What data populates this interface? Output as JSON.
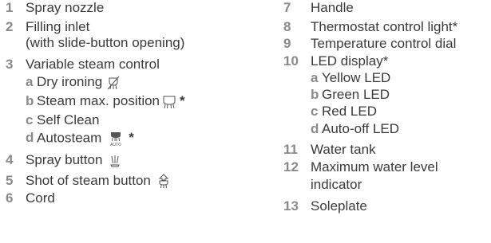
{
  "left_items": [
    {
      "num": "1",
      "label": "Spray nozzle"
    },
    {
      "num": "2",
      "label": "Filling inlet",
      "cont": "(with slide-button opening)"
    },
    {
      "num": "3",
      "label": "Variable steam control",
      "subs": [
        {
          "letter": "a",
          "label": "Dry ironing",
          "icon": "dry-ironing-icon"
        },
        {
          "letter": "b",
          "label": "Steam max. position",
          "icon": "steam-max-icon",
          "star": "*"
        },
        {
          "letter": "c",
          "label": "Self Clean"
        },
        {
          "letter": "d",
          "label": "Autosteam",
          "icon": "autosteam-icon",
          "icon_text": "AUTO",
          "star": "*"
        }
      ]
    },
    {
      "num": "4",
      "label": "Spray button",
      "icon": "spray-icon"
    },
    {
      "num": "5",
      "label": "Shot of steam button",
      "icon": "shot-of-steam-icon"
    },
    {
      "num": "6",
      "label": "Cord"
    }
  ],
  "right_items": [
    {
      "num": "7",
      "label": "Handle"
    },
    {
      "num": "8",
      "label": "Thermostat control light*"
    },
    {
      "num": "9",
      "label": "Temperature control dial"
    },
    {
      "num": "10",
      "label": "LED display*",
      "subs": [
        {
          "letter": "a",
          "label": "Yellow LED"
        },
        {
          "letter": "b",
          "label": "Green LED"
        },
        {
          "letter": "c",
          "label": "Red LED"
        },
        {
          "letter": "d",
          "label": "Auto-off LED"
        }
      ]
    },
    {
      "num": "11",
      "label": "Water tank"
    },
    {
      "num": "12",
      "label": "Maximum water level",
      "cont": "indicator"
    },
    {
      "num": "13",
      "label": "Soleplate"
    }
  ],
  "colors": {
    "text": "#3a3a3a",
    "numbers": "#8a8a8a",
    "background": "#ffffff"
  }
}
